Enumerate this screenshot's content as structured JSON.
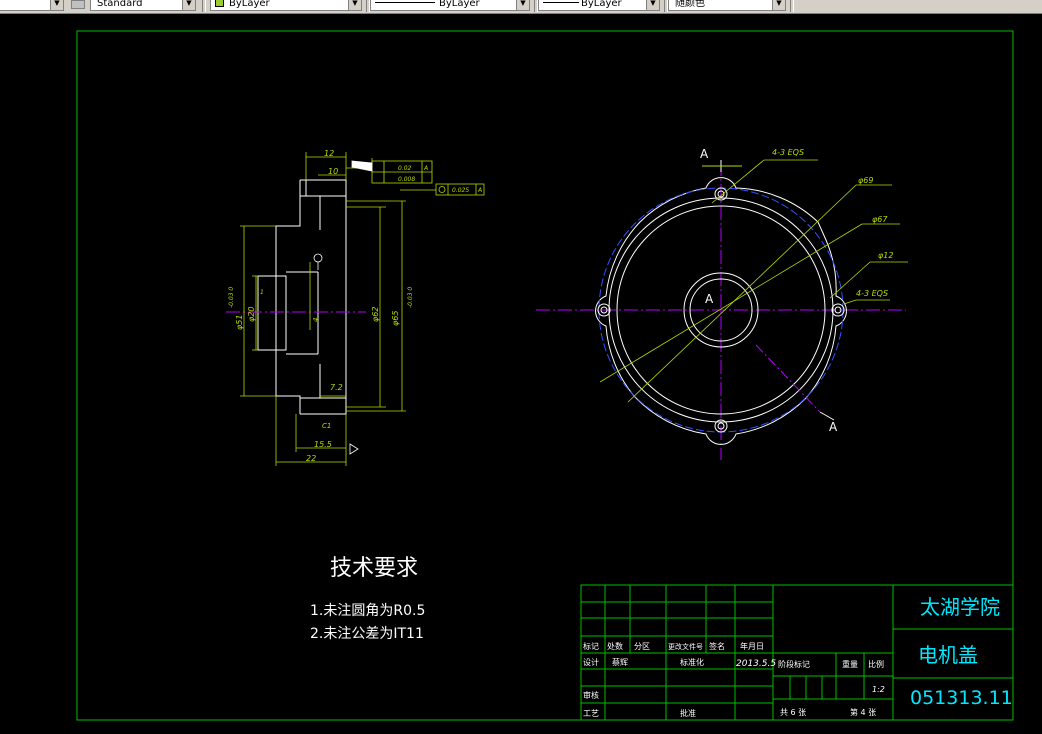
{
  "toolbar": {
    "text_style": "Standard",
    "layer_color": "ByLayer",
    "linetype": "ByLayer",
    "lineweight": "ByLayer",
    "plot_style": "随颜色"
  },
  "drawing": {
    "tech_req_title": "技术要求",
    "tech_req_1": "1.未注圆角为R0.5",
    "tech_req_2": "2.未注公差为IT11",
    "section_label_a": "A",
    "dims": {
      "d12": "12",
      "d10": "10",
      "tol_box1": "0.02",
      "tol_box2": "0.008",
      "datum": "A",
      "concentric": "0.025",
      "d51": "φ51",
      "d51_tol": "-0.03 0",
      "d20": "φ20",
      "d62": "φ62",
      "d65": "φ65",
      "d65_tol": "-0.03 0",
      "d7_2": "7.2",
      "d15_5": "15.5",
      "d22": "22",
      "d1": "1",
      "d4": "4",
      "c_1": "C1",
      "hole_label": "4-3 EQS",
      "phi69": "φ69",
      "phi67": "φ67",
      "phi12": "φ12",
      "hole_label2": "4-3 EQS"
    }
  },
  "title_block": {
    "school": "太湖学院",
    "part_name": "电机盖",
    "drawing_no": "051313.11",
    "mark": "标记",
    "count": "处数",
    "zone": "分区",
    "change_doc": "更改文件号",
    "sign": "签名",
    "date": "年月日",
    "design": "设计",
    "designer": "蔡辉",
    "standardize": "标准化",
    "design_date": "2013.5.5",
    "stage_mark": "阶段标记",
    "weight": "重量",
    "scale": "比例",
    "scale_value": "1:2",
    "review": "审核",
    "process": "工艺",
    "approve": "批准",
    "total_sheets": "共 6 张",
    "sheet_no": "第 4 张"
  }
}
